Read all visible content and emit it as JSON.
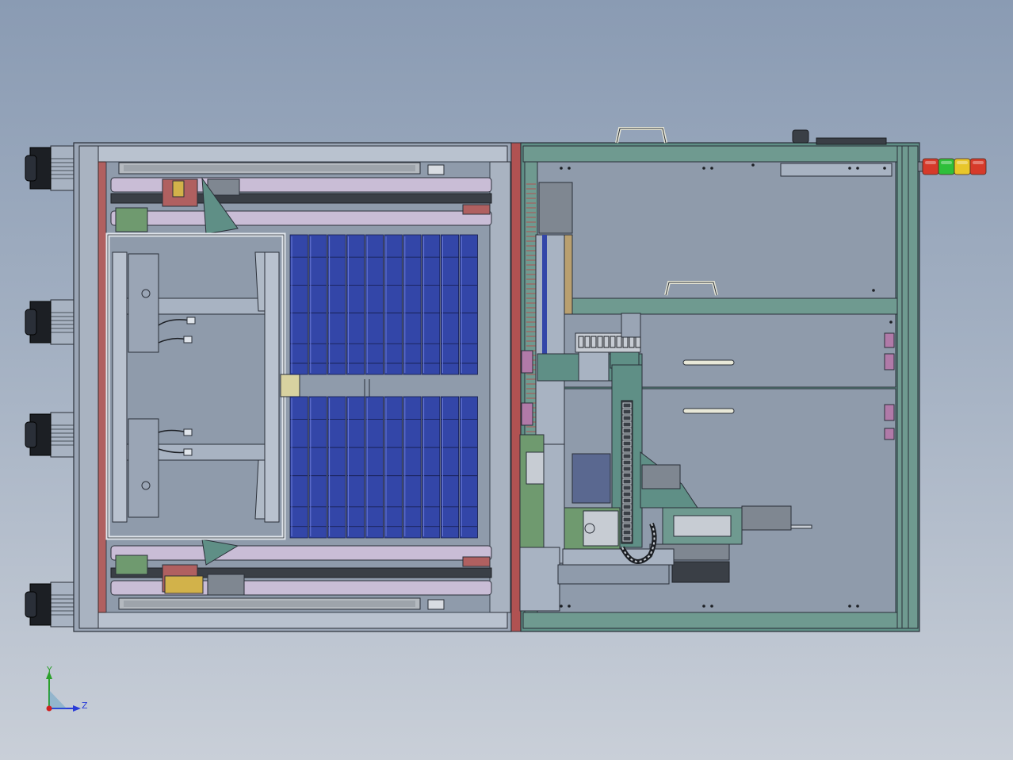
{
  "triad": {
    "y_label": "Y",
    "z_label": "Z"
  },
  "colors": {
    "background_top": "#8a9bb3",
    "background_bottom": "#c9cfd8",
    "frame_steel": "#a8b3c2",
    "frame_green": "#5f8f86",
    "panel_grey": "#8f9bab",
    "rod_lavender": "#c9bdd6",
    "tray_blue": "#3346a8",
    "accent_red": "#b05252",
    "axis_y": "#2ba02b",
    "axis_z": "#2a3cd8",
    "origin": "#d02020"
  },
  "tower_light": [
    "red",
    "green",
    "yellow",
    "red"
  ],
  "casters": 4,
  "tray_columns": 10,
  "tray_stacks": 2
}
